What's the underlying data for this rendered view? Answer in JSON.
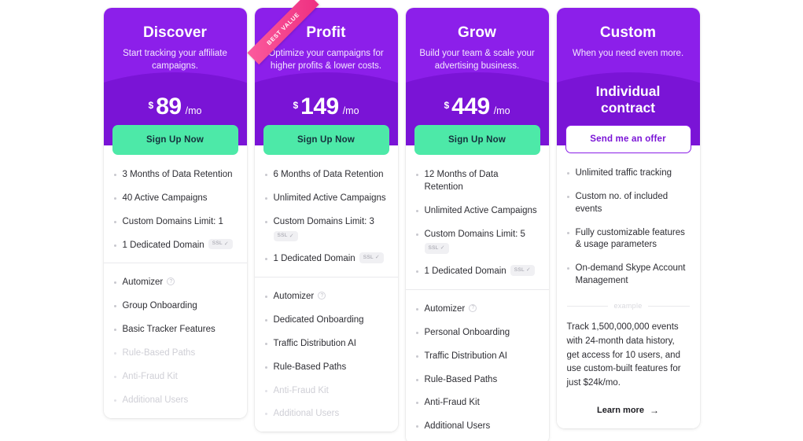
{
  "theme": {
    "purple": "#8A1EE8",
    "purple_dark": "#7a14d6",
    "green": "#4de9a8",
    "pink": "#ee2f80"
  },
  "ribbon": {
    "label": "BEST VALUE"
  },
  "badges": {
    "ssl_label": "SSL",
    "ssl_check": "✓",
    "info": "?"
  },
  "example_divider_label": "example",
  "learn_more": {
    "label": "Learn more",
    "arrow": "→"
  },
  "plans": [
    {
      "name": "Discover",
      "desc": "Start tracking your affiliate campaigns.",
      "currency": "$",
      "amount": "89",
      "period": "/mo",
      "cta": "Sign Up Now",
      "features_a": [
        {
          "text": "3 Months of Data Retention",
          "enabled": true,
          "ssl": false
        },
        {
          "text": "40 Active Campaigns",
          "enabled": true,
          "ssl": false
        },
        {
          "text": "Custom Domains Limit: 1",
          "enabled": true,
          "ssl": false
        },
        {
          "text": "1 Dedicated Domain",
          "enabled": true,
          "ssl": true
        }
      ],
      "features_b": [
        {
          "text": "Automizer",
          "enabled": true,
          "info": true
        },
        {
          "text": "Group Onboarding",
          "enabled": true
        },
        {
          "text": "Basic Tracker Features",
          "enabled": true
        },
        {
          "text": "Rule-Based Paths",
          "enabled": false
        },
        {
          "text": "Anti-Fraud Kit",
          "enabled": false
        },
        {
          "text": "Additional Users",
          "enabled": false
        }
      ]
    },
    {
      "name": "Profit",
      "desc": "Optimize your campaigns for higher profits & lower costs.",
      "currency": "$",
      "amount": "149",
      "period": "/mo",
      "cta": "Sign Up Now",
      "best_value": true,
      "features_a": [
        {
          "text": "6 Months of Data Retention",
          "enabled": true,
          "ssl": false
        },
        {
          "text": "Unlimited Active Campaigns",
          "enabled": true,
          "ssl": false
        },
        {
          "text": "Custom Domains Limit: 3",
          "enabled": true,
          "ssl_below": true
        },
        {
          "text": "1 Dedicated Domain",
          "enabled": true,
          "ssl": true
        }
      ],
      "features_b": [
        {
          "text": "Automizer",
          "enabled": true,
          "info": true
        },
        {
          "text": "Dedicated Onboarding",
          "enabled": true
        },
        {
          "text": "Traffic Distribution AI",
          "enabled": true
        },
        {
          "text": "Rule-Based Paths",
          "enabled": true
        },
        {
          "text": "Anti-Fraud Kit",
          "enabled": false
        },
        {
          "text": "Additional Users",
          "enabled": false
        }
      ]
    },
    {
      "name": "Grow",
      "desc": "Build your team & scale your advertising business.",
      "currency": "$",
      "amount": "449",
      "period": "/mo",
      "cta": "Sign Up Now",
      "features_a": [
        {
          "text": "12 Months of Data Retention",
          "enabled": true,
          "ssl": false
        },
        {
          "text": "Unlimited Active Campaigns",
          "enabled": true,
          "ssl": false
        },
        {
          "text": "Custom Domains Limit: 5",
          "enabled": true,
          "ssl_below": true
        },
        {
          "text": "1 Dedicated Domain",
          "enabled": true,
          "ssl": true
        }
      ],
      "features_b": [
        {
          "text": "Automizer",
          "enabled": true,
          "info": true
        },
        {
          "text": "Personal Onboarding",
          "enabled": true
        },
        {
          "text": "Traffic Distribution AI",
          "enabled": true
        },
        {
          "text": "Rule-Based Paths",
          "enabled": true
        },
        {
          "text": "Anti-Fraud Kit",
          "enabled": true
        },
        {
          "text": "Additional Users",
          "enabled": true
        }
      ]
    },
    {
      "name": "Custom",
      "desc": "When you need even more.",
      "contract_label": "Individual contract",
      "cta": "Send me an offer",
      "cta_style": "outline",
      "features_a": [
        {
          "text": "Unlimited traffic tracking",
          "enabled": true
        },
        {
          "text": "Custom no. of included events",
          "enabled": true
        },
        {
          "text": "Fully customizable features & usage parameters",
          "enabled": true
        },
        {
          "text": "On-demand Skype Account Management",
          "enabled": true
        }
      ],
      "example_text": "Track 1,500,000,000 events with 24-month data history, get access for 10 users, and use custom-built features for just $24k/mo."
    }
  ]
}
